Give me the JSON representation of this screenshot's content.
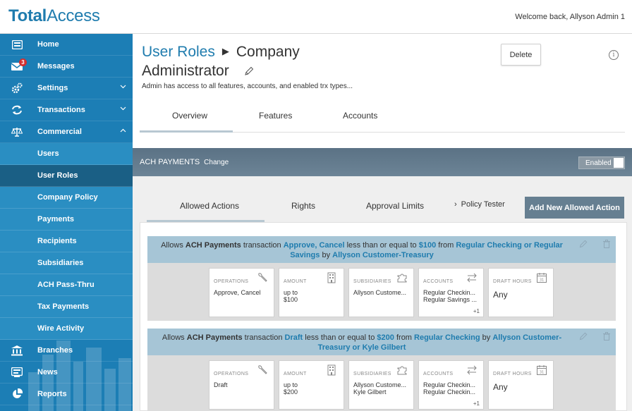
{
  "app": {
    "logo_bold": "Total",
    "logo_light": "Access",
    "welcome": "Welcome back, Allyson Admin 1"
  },
  "sidebar": {
    "items": [
      {
        "label": "Home",
        "icon": "home-icon"
      },
      {
        "label": "Messages",
        "icon": "mail-icon",
        "badge": "3"
      },
      {
        "label": "Settings",
        "icon": "gear-icon",
        "chevron": "chevron-down"
      },
      {
        "label": "Transactions",
        "icon": "transfer-icon",
        "chevron": "chevron-down"
      },
      {
        "label": "Commercial",
        "icon": "scale-icon",
        "chevron": "chevron-up"
      }
    ],
    "subitems": [
      {
        "label": "Users"
      },
      {
        "label": "User Roles",
        "active": true
      },
      {
        "label": "Company Policy"
      },
      {
        "label": "Payments"
      },
      {
        "label": "Recipients"
      },
      {
        "label": "Subsidiaries"
      },
      {
        "label": "ACH Pass-Thru"
      },
      {
        "label": "Tax Payments"
      },
      {
        "label": "Wire Activity"
      }
    ],
    "bottom_items": [
      {
        "label": "Branches",
        "icon": "bank-icon"
      },
      {
        "label": "News",
        "icon": "news-icon"
      },
      {
        "label": "Reports",
        "icon": "pie-chart-icon"
      }
    ]
  },
  "header": {
    "breadcrumb": "User Roles",
    "title_part1": "Company",
    "title_part2": "Administrator",
    "description": "Admin has access to all features, accounts, and enabled trx types...",
    "delete_label": "Delete",
    "info_glyph": "i"
  },
  "tabs": [
    {
      "label": "Overview"
    },
    {
      "label": "Features"
    },
    {
      "label": "Accounts"
    }
  ],
  "section": {
    "title": "ACH PAYMENTS",
    "change_label": "Change",
    "toggle_label": "Enabled"
  },
  "subtabs": [
    {
      "label": "Allowed Actions"
    },
    {
      "label": "Rights"
    },
    {
      "label": "Approval Limits"
    },
    {
      "label": "Policy Tester"
    }
  ],
  "add_button_label": "Add New Allowed Action",
  "rules": [
    {
      "prefix": "Allows",
      "type": "ACH Payments",
      "mid1": "transaction",
      "actions": "Approve, Cancel",
      "mid2": "less than or equal to",
      "amount": "$100",
      "mid3": "from",
      "accounts": "Regular Checking or Regular Savings",
      "mid4": "by",
      "by": "Allyson Customer-Treasury",
      "cards": {
        "operations": {
          "label": "OPERATIONS",
          "value": "Approve, Cancel"
        },
        "amount": {
          "label": "AMOUNT",
          "value1": "up to",
          "value2": "$100"
        },
        "subsidiaries": {
          "label": "SUBSIDIARIES",
          "value1": "Allyson Custome...",
          "value2": ""
        },
        "accounts": {
          "label": "ACCOUNTS",
          "value1": "Regular Checkin...",
          "value2": "Regular Savings ...",
          "more": "+1"
        },
        "draft_hours": {
          "label": "DRAFT HOURS",
          "value": "Any"
        }
      }
    },
    {
      "prefix": "Allows",
      "type": "ACH Payments",
      "mid1": "transaction",
      "actions": "Draft",
      "mid2": "less than or equal to",
      "amount": "$200",
      "mid3": "from",
      "accounts": "Regular Checking",
      "mid4": "by",
      "by": "Allyson Customer-Treasury or Kyle Gilbert",
      "cards": {
        "operations": {
          "label": "OPERATIONS",
          "value": "Draft"
        },
        "amount": {
          "label": "AMOUNT",
          "value1": "up to",
          "value2": "$200"
        },
        "subsidiaries": {
          "label": "SUBSIDIARIES",
          "value1": "Allyson Custome...",
          "value2": "Kyle Gilbert"
        },
        "accounts": {
          "label": "ACCOUNTS",
          "value1": "Regular Checkin...",
          "value2": "Regular Checkin...",
          "more": "+1"
        },
        "draft_hours": {
          "label": "DRAFT HOURS",
          "value": "Any"
        }
      }
    }
  ],
  "colors": {
    "brand": "#1f7cae",
    "sidebar": "#1c7eb5",
    "sidebar_active": "#1a5f85",
    "section_bar": "#5b7285",
    "rule_head": "#a6c5d6"
  }
}
